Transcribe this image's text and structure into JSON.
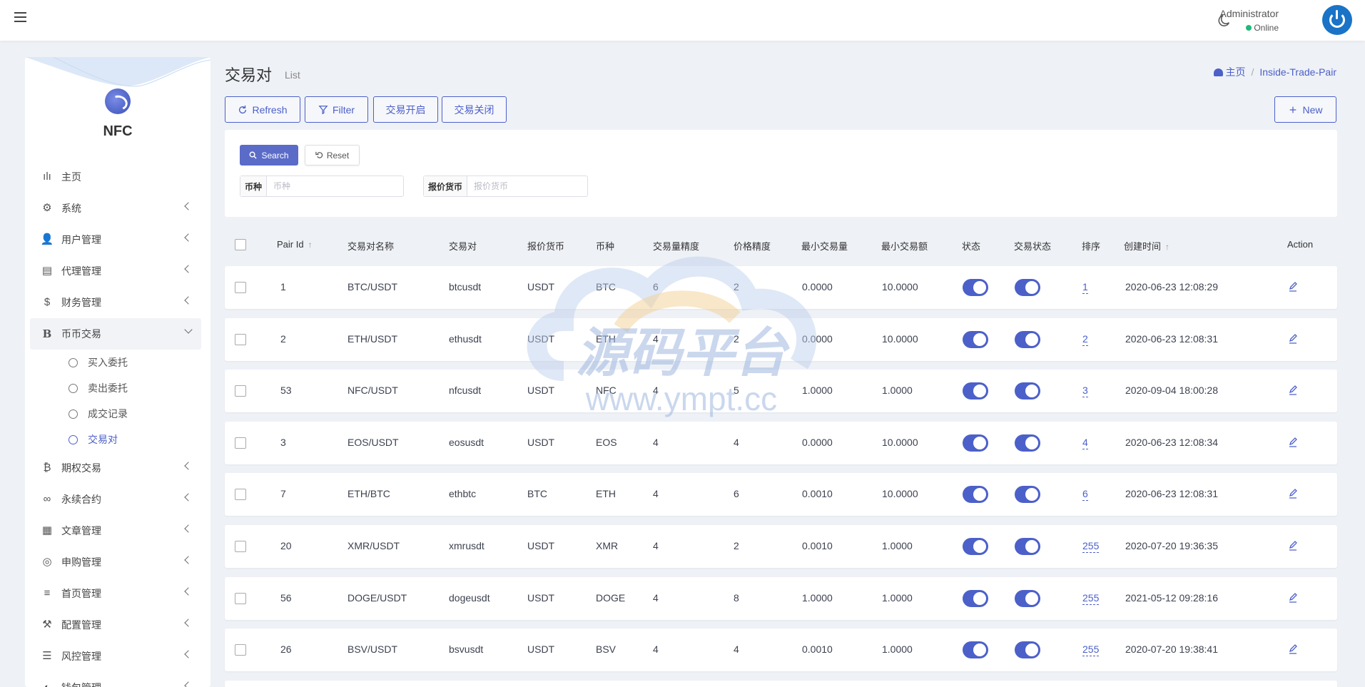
{
  "topbar": {
    "user_name": "Administrator",
    "user_status": "Online"
  },
  "sidebar": {
    "brand": "NFC",
    "items": [
      {
        "label": "主页",
        "icon": "bar-chart-icon",
        "arrow": false
      },
      {
        "label": "系统",
        "icon": "gear-icon",
        "arrow": true
      },
      {
        "label": "用户管理",
        "icon": "user-icon",
        "arrow": true
      },
      {
        "label": "代理管理",
        "icon": "id-card-icon",
        "arrow": true
      },
      {
        "label": "财务管理",
        "icon": "dollar-icon",
        "arrow": true
      },
      {
        "label": "币币交易",
        "icon": "bitcoin-b-icon",
        "arrow": true,
        "open": true
      }
    ],
    "sub_items": [
      {
        "label": "买入委托"
      },
      {
        "label": "卖出委托"
      },
      {
        "label": "成交记录"
      },
      {
        "label": "交易对",
        "active": true
      }
    ],
    "items_after": [
      {
        "label": "期权交易",
        "icon": "bitcoin-icon"
      },
      {
        "label": "永续合约",
        "icon": "link-icon"
      },
      {
        "label": "文章管理",
        "icon": "newspaper-icon"
      },
      {
        "label": "申购管理",
        "icon": "lifebuoy-icon"
      },
      {
        "label": "首页管理",
        "icon": "bars-icon"
      },
      {
        "label": "配置管理",
        "icon": "wrench-icon"
      },
      {
        "label": "风控管理",
        "icon": "list-icon"
      },
      {
        "label": "钱包管理",
        "icon": "wallet-icon"
      }
    ]
  },
  "header": {
    "title": "交易对",
    "subtitle": "List",
    "breadcrumb_home": "主页",
    "breadcrumb_current": "Inside-Trade-Pair"
  },
  "toolbar": {
    "refresh": "Refresh",
    "filter": "Filter",
    "open_trade": "交易开启",
    "close_trade": "交易关闭",
    "new": "New"
  },
  "search": {
    "search_label": "Search",
    "reset_label": "Reset",
    "field1_label": "币种",
    "field1_placeholder": "币种",
    "field2_label": "报价货币",
    "field2_placeholder": "报价货币"
  },
  "table": {
    "columns": [
      "Pair Id",
      "交易对名称",
      "交易对",
      "报价货币",
      "币种",
      "交易量精度",
      "价格精度",
      "最小交易量",
      "最小交易额",
      "状态",
      "交易状态",
      "排序",
      "创建时间",
      "Action"
    ],
    "rows": [
      {
        "id": "1",
        "name": "BTC/USDT",
        "symbol": "btcusdt",
        "quote": "USDT",
        "coin": "BTC",
        "vol_precision": "6",
        "price_precision": "2",
        "min_vol": "0.0000",
        "min_amount": "10.0000",
        "status": true,
        "trade_status": true,
        "sort": "1",
        "created": "2020-06-23 12:08:29"
      },
      {
        "id": "2",
        "name": "ETH/USDT",
        "symbol": "ethusdt",
        "quote": "USDT",
        "coin": "ETH",
        "vol_precision": "4",
        "price_precision": "2",
        "min_vol": "0.0000",
        "min_amount": "10.0000",
        "status": true,
        "trade_status": true,
        "sort": "2",
        "created": "2020-06-23 12:08:31"
      },
      {
        "id": "53",
        "name": "NFC/USDT",
        "symbol": "nfcusdt",
        "quote": "USDT",
        "coin": "NFC",
        "vol_precision": "4",
        "price_precision": "5",
        "min_vol": "1.0000",
        "min_amount": "1.0000",
        "status": true,
        "trade_status": true,
        "sort": "3",
        "created": "2020-09-04 18:00:28"
      },
      {
        "id": "3",
        "name": "EOS/USDT",
        "symbol": "eosusdt",
        "quote": "USDT",
        "coin": "EOS",
        "vol_precision": "4",
        "price_precision": "4",
        "min_vol": "0.0000",
        "min_amount": "10.0000",
        "status": true,
        "trade_status": true,
        "sort": "4",
        "created": "2020-06-23 12:08:34"
      },
      {
        "id": "7",
        "name": "ETH/BTC",
        "symbol": "ethbtc",
        "quote": "BTC",
        "coin": "ETH",
        "vol_precision": "4",
        "price_precision": "6",
        "min_vol": "0.0010",
        "min_amount": "10.0000",
        "status": true,
        "trade_status": true,
        "sort": "6",
        "created": "2020-06-23 12:08:31"
      },
      {
        "id": "20",
        "name": "XMR/USDT",
        "symbol": "xmrusdt",
        "quote": "USDT",
        "coin": "XMR",
        "vol_precision": "4",
        "price_precision": "2",
        "min_vol": "0.0010",
        "min_amount": "1.0000",
        "status": true,
        "trade_status": true,
        "sort": "255",
        "created": "2020-07-20 19:36:35"
      },
      {
        "id": "56",
        "name": "DOGE/USDT",
        "symbol": "dogeusdt",
        "quote": "USDT",
        "coin": "DOGE",
        "vol_precision": "4",
        "price_precision": "8",
        "min_vol": "1.0000",
        "min_amount": "1.0000",
        "status": true,
        "trade_status": true,
        "sort": "255",
        "created": "2021-05-12 09:28:16"
      },
      {
        "id": "26",
        "name": "BSV/USDT",
        "symbol": "bsvusdt",
        "quote": "USDT",
        "coin": "BSV",
        "vol_precision": "4",
        "price_precision": "4",
        "min_vol": "0.0010",
        "min_amount": "1.0000",
        "status": true,
        "trade_status": true,
        "sort": "255",
        "created": "2020-07-20 19:38:41"
      }
    ]
  },
  "watermark": {
    "title": "源码平台",
    "url": "www.ympt.cc"
  },
  "colors": {
    "accent": "#4c60c9",
    "online": "#21b978",
    "background": "#eef1f6"
  }
}
